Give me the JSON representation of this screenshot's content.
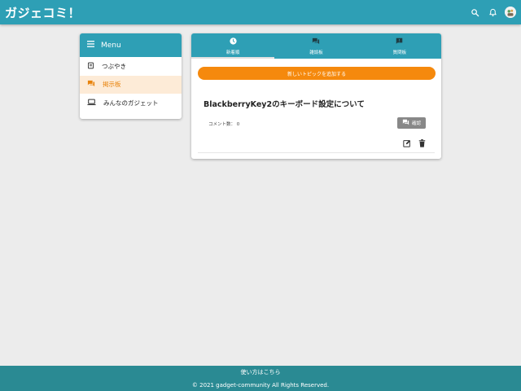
{
  "header": {
    "title": "ガジェコミ！",
    "icons": [
      "search-icon",
      "bell-icon",
      "avatar"
    ]
  },
  "sidebar": {
    "title": "Menu",
    "items": [
      {
        "label": "つぶやき",
        "icon": "note-icon",
        "active": false
      },
      {
        "label": "掲示板",
        "icon": "forum-icon",
        "active": true
      },
      {
        "label": "みんなのガジェット",
        "icon": "laptop-icon",
        "active": false
      }
    ]
  },
  "tabs": [
    {
      "label": "新着順",
      "icon": "clock-icon",
      "active": true
    },
    {
      "label": "雑談板",
      "icon": "forum-icon",
      "active": false
    },
    {
      "label": "質問板",
      "icon": "feedback-icon",
      "active": false
    }
  ],
  "main": {
    "add_topic_label": "新しいトピックを追加する",
    "topic": {
      "title": "BlackberryKey2のキーボード設定について",
      "comment_count_label": "コメント数：",
      "comment_count": "0",
      "confirm_label": "確認"
    }
  },
  "footer": {
    "help_link": "使い方はこちら",
    "copyright": "© 2021 gadget-community All Rights Reserved."
  },
  "colors": {
    "primary": "#2e9fb5",
    "accent": "#f5890d",
    "footer": "#2a8a93",
    "active_bg": "#fdebd7"
  }
}
